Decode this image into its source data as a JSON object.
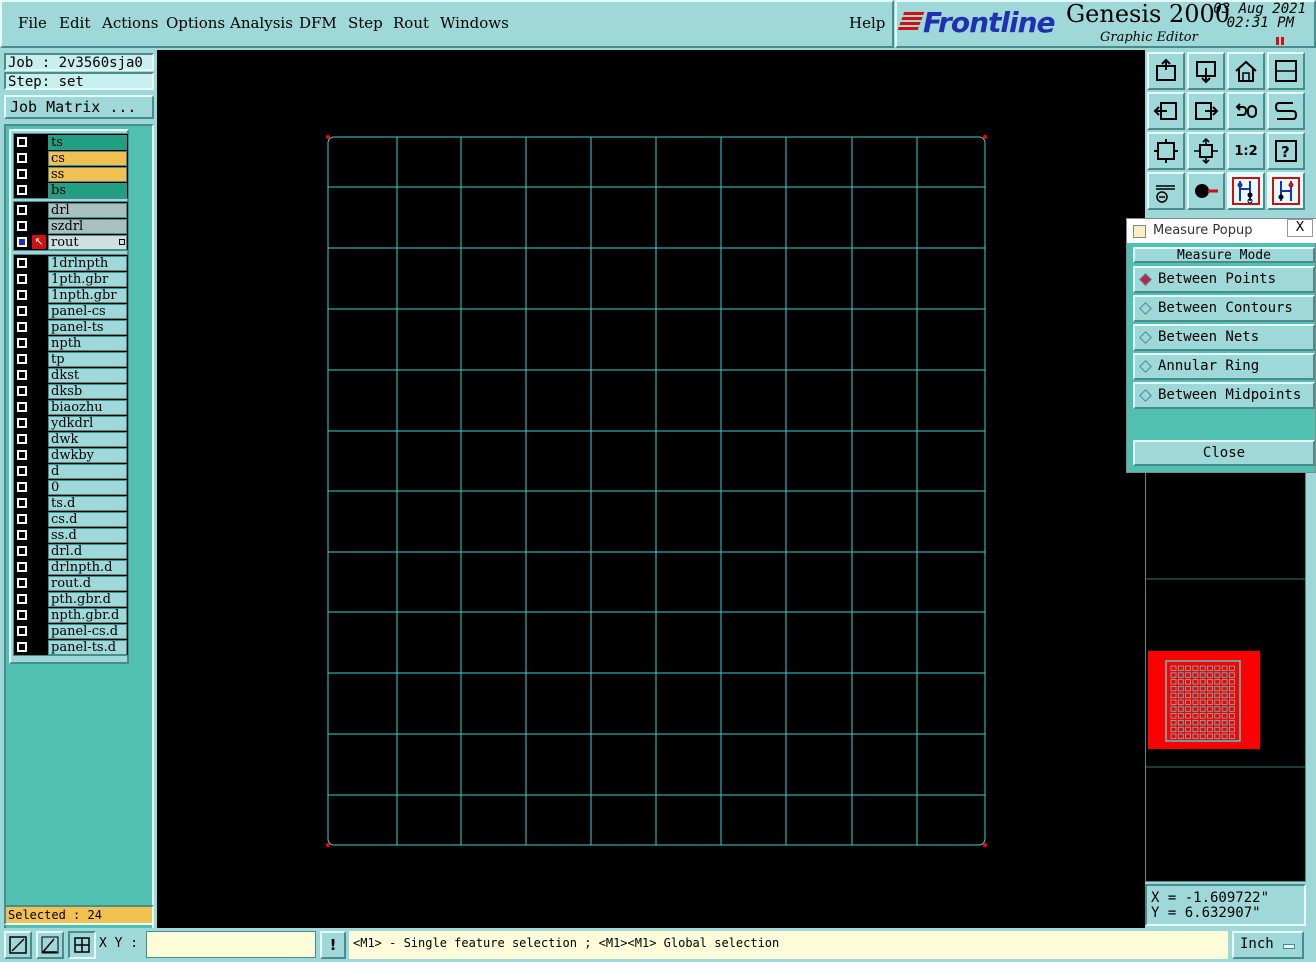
{
  "menubar": {
    "items": [
      {
        "label": "File"
      },
      {
        "label": "Edit"
      },
      {
        "label": "Actions"
      },
      {
        "label": "Options"
      },
      {
        "label": "Analysis"
      },
      {
        "label": "DFM"
      },
      {
        "label": "Step"
      },
      {
        "label": "Rout"
      },
      {
        "label": "Windows"
      }
    ],
    "help": "Help"
  },
  "brand": {
    "logo": "Frontline",
    "title": "Genesis 2000",
    "subtitle": "Graphic Editor",
    "date": "03 Aug 2021",
    "time": "02:31 PM"
  },
  "job": {
    "job_label": "Job : 2v3560sja0",
    "step_label": "Step: set",
    "matrix_button": "Job Matrix ..."
  },
  "layers": {
    "group1": [
      {
        "name": "ts",
        "color": "#20a080"
      },
      {
        "name": "cs",
        "color": "#f0c050"
      },
      {
        "name": "ss",
        "color": "#f0c050"
      },
      {
        "name": "bs",
        "color": "#20a080"
      }
    ],
    "group2": [
      {
        "name": "drl",
        "color": "#a8c0c0"
      },
      {
        "name": "szdrl",
        "color": "#a8c0c0"
      },
      {
        "name": "rout",
        "color": "#d0e0e0"
      }
    ],
    "group3": [
      {
        "name": "1drlnpth"
      },
      {
        "name": "1pth.gbr"
      },
      {
        "name": "1npth.gbr"
      },
      {
        "name": "panel-cs"
      },
      {
        "name": "panel-ts"
      },
      {
        "name": "npth"
      },
      {
        "name": "tp"
      },
      {
        "name": "dkst"
      },
      {
        "name": "dksb"
      },
      {
        "name": "biaozhu"
      },
      {
        "name": "ydkdrl"
      },
      {
        "name": "dwk"
      },
      {
        "name": "dwkby"
      },
      {
        "name": "d"
      },
      {
        "name": "0"
      },
      {
        "name": "ts.d"
      },
      {
        "name": "cs.d"
      },
      {
        "name": "ss.d"
      },
      {
        "name": "drl.d"
      },
      {
        "name": "drlnpth.d"
      },
      {
        "name": "rout.d"
      },
      {
        "name": "pth.gbr.d"
      },
      {
        "name": "npth.gbr.d"
      },
      {
        "name": "panel-cs.d"
      },
      {
        "name": "panel-ts.d"
      }
    ]
  },
  "selected": "Selected : 24",
  "measure_popup": {
    "title": "Measure Popup",
    "close_x": "X",
    "mode_header": "Measure Mode",
    "options": [
      {
        "label": "Between Points",
        "selected": true
      },
      {
        "label": "Between Contours",
        "selected": false
      },
      {
        "label": "Between Nets",
        "selected": false
      },
      {
        "label": "Annular Ring",
        "selected": false
      },
      {
        "label": "Between Midpoints",
        "selected": false
      }
    ],
    "close_button": "Close"
  },
  "coords": {
    "x": "X = -1.609722\"",
    "y": "Y = 6.632907\""
  },
  "statusbar": {
    "xy_label": "X Y :",
    "xy_value": "",
    "warn": "!",
    "message": "<M1> - Single feature selection ; <M1><M1> Global selection",
    "unit": "Inch"
  },
  "colors": {
    "grid": "#40d0d0",
    "panel": "#9ed8d8",
    "highlight_red": "#ff0000"
  }
}
